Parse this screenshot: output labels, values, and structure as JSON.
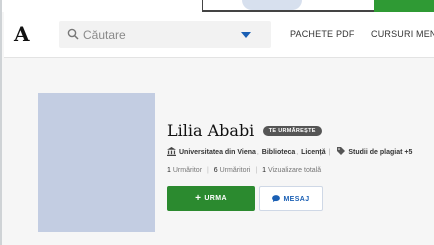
{
  "header": {
    "logo": "A",
    "search": {
      "placeholder": "Căutare"
    },
    "nav": [
      "PACHETE PDF",
      "CURSURI",
      "MENT"
    ]
  },
  "profile": {
    "name": "Lilia Ababi",
    "badge": "TE URMĂREȘTE",
    "university": "Universitatea din Viena",
    "library": "Biblioteca",
    "degree": "Licență",
    "study_field": "Studii de plagiat",
    "more_fields": "+5",
    "stats": {
      "followers_count": "1",
      "followers_label": "Urmăritor",
      "following_count": "6",
      "following_label": "Urmăritori",
      "views_count": "1",
      "views_label": "Vizualizare totală"
    },
    "follow_button": "URMA",
    "message_button": "MESAJ"
  },
  "icons": {
    "search": "search-icon",
    "dropdown": "caret-down-icon",
    "institution": "bank-icon",
    "tag": "tag-icon",
    "plus": "plus-icon",
    "message": "chat-bubble-icon"
  },
  "colors": {
    "accent_blue": "#1a5fb4",
    "follow_green": "#2b8a2f",
    "avatar_bg": "#c3cde2",
    "badge_bg": "#555555"
  }
}
